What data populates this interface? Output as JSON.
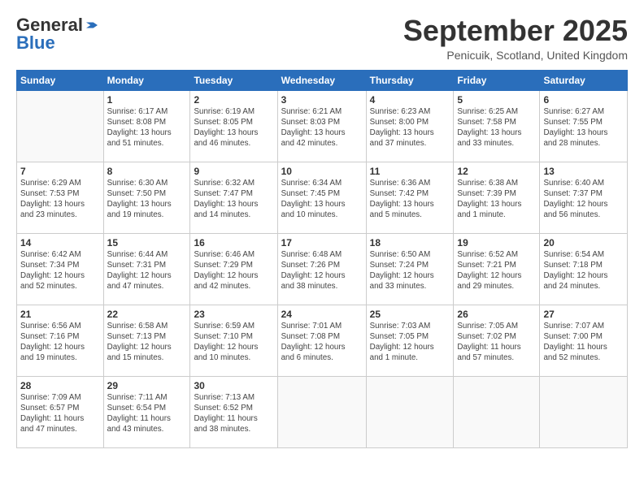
{
  "header": {
    "logo_general": "General",
    "logo_blue": "Blue",
    "month_title": "September 2025",
    "location": "Penicuik, Scotland, United Kingdom"
  },
  "days_of_week": [
    "Sunday",
    "Monday",
    "Tuesday",
    "Wednesday",
    "Thursday",
    "Friday",
    "Saturday"
  ],
  "weeks": [
    [
      {
        "day": "",
        "info": ""
      },
      {
        "day": "1",
        "info": "Sunrise: 6:17 AM\nSunset: 8:08 PM\nDaylight: 13 hours\nand 51 minutes."
      },
      {
        "day": "2",
        "info": "Sunrise: 6:19 AM\nSunset: 8:05 PM\nDaylight: 13 hours\nand 46 minutes."
      },
      {
        "day": "3",
        "info": "Sunrise: 6:21 AM\nSunset: 8:03 PM\nDaylight: 13 hours\nand 42 minutes."
      },
      {
        "day": "4",
        "info": "Sunrise: 6:23 AM\nSunset: 8:00 PM\nDaylight: 13 hours\nand 37 minutes."
      },
      {
        "day": "5",
        "info": "Sunrise: 6:25 AM\nSunset: 7:58 PM\nDaylight: 13 hours\nand 33 minutes."
      },
      {
        "day": "6",
        "info": "Sunrise: 6:27 AM\nSunset: 7:55 PM\nDaylight: 13 hours\nand 28 minutes."
      }
    ],
    [
      {
        "day": "7",
        "info": "Sunrise: 6:29 AM\nSunset: 7:53 PM\nDaylight: 13 hours\nand 23 minutes."
      },
      {
        "day": "8",
        "info": "Sunrise: 6:30 AM\nSunset: 7:50 PM\nDaylight: 13 hours\nand 19 minutes."
      },
      {
        "day": "9",
        "info": "Sunrise: 6:32 AM\nSunset: 7:47 PM\nDaylight: 13 hours\nand 14 minutes."
      },
      {
        "day": "10",
        "info": "Sunrise: 6:34 AM\nSunset: 7:45 PM\nDaylight: 13 hours\nand 10 minutes."
      },
      {
        "day": "11",
        "info": "Sunrise: 6:36 AM\nSunset: 7:42 PM\nDaylight: 13 hours\nand 5 minutes."
      },
      {
        "day": "12",
        "info": "Sunrise: 6:38 AM\nSunset: 7:39 PM\nDaylight: 13 hours\nand 1 minute."
      },
      {
        "day": "13",
        "info": "Sunrise: 6:40 AM\nSunset: 7:37 PM\nDaylight: 12 hours\nand 56 minutes."
      }
    ],
    [
      {
        "day": "14",
        "info": "Sunrise: 6:42 AM\nSunset: 7:34 PM\nDaylight: 12 hours\nand 52 minutes."
      },
      {
        "day": "15",
        "info": "Sunrise: 6:44 AM\nSunset: 7:31 PM\nDaylight: 12 hours\nand 47 minutes."
      },
      {
        "day": "16",
        "info": "Sunrise: 6:46 AM\nSunset: 7:29 PM\nDaylight: 12 hours\nand 42 minutes."
      },
      {
        "day": "17",
        "info": "Sunrise: 6:48 AM\nSunset: 7:26 PM\nDaylight: 12 hours\nand 38 minutes."
      },
      {
        "day": "18",
        "info": "Sunrise: 6:50 AM\nSunset: 7:24 PM\nDaylight: 12 hours\nand 33 minutes."
      },
      {
        "day": "19",
        "info": "Sunrise: 6:52 AM\nSunset: 7:21 PM\nDaylight: 12 hours\nand 29 minutes."
      },
      {
        "day": "20",
        "info": "Sunrise: 6:54 AM\nSunset: 7:18 PM\nDaylight: 12 hours\nand 24 minutes."
      }
    ],
    [
      {
        "day": "21",
        "info": "Sunrise: 6:56 AM\nSunset: 7:16 PM\nDaylight: 12 hours\nand 19 minutes."
      },
      {
        "day": "22",
        "info": "Sunrise: 6:58 AM\nSunset: 7:13 PM\nDaylight: 12 hours\nand 15 minutes."
      },
      {
        "day": "23",
        "info": "Sunrise: 6:59 AM\nSunset: 7:10 PM\nDaylight: 12 hours\nand 10 minutes."
      },
      {
        "day": "24",
        "info": "Sunrise: 7:01 AM\nSunset: 7:08 PM\nDaylight: 12 hours\nand 6 minutes."
      },
      {
        "day": "25",
        "info": "Sunrise: 7:03 AM\nSunset: 7:05 PM\nDaylight: 12 hours\nand 1 minute."
      },
      {
        "day": "26",
        "info": "Sunrise: 7:05 AM\nSunset: 7:02 PM\nDaylight: 11 hours\nand 57 minutes."
      },
      {
        "day": "27",
        "info": "Sunrise: 7:07 AM\nSunset: 7:00 PM\nDaylight: 11 hours\nand 52 minutes."
      }
    ],
    [
      {
        "day": "28",
        "info": "Sunrise: 7:09 AM\nSunset: 6:57 PM\nDaylight: 11 hours\nand 47 minutes."
      },
      {
        "day": "29",
        "info": "Sunrise: 7:11 AM\nSunset: 6:54 PM\nDaylight: 11 hours\nand 43 minutes."
      },
      {
        "day": "30",
        "info": "Sunrise: 7:13 AM\nSunset: 6:52 PM\nDaylight: 11 hours\nand 38 minutes."
      },
      {
        "day": "",
        "info": ""
      },
      {
        "day": "",
        "info": ""
      },
      {
        "day": "",
        "info": ""
      },
      {
        "day": "",
        "info": ""
      }
    ]
  ]
}
